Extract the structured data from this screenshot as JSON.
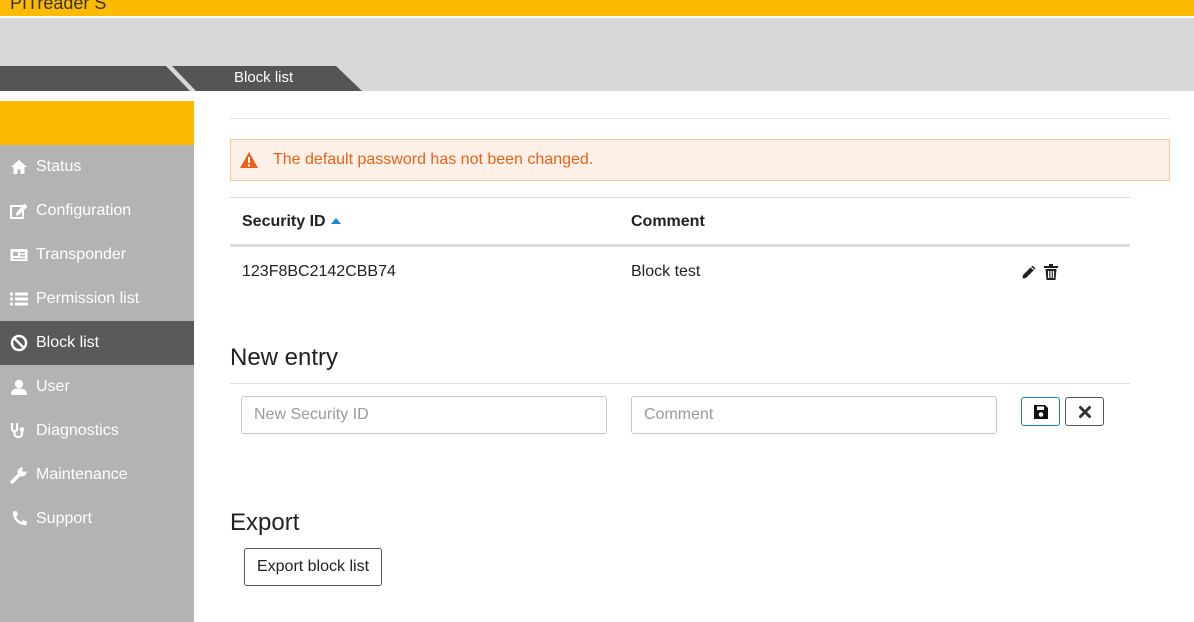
{
  "app": {
    "title": "PITreader S"
  },
  "breadcrumb": {
    "current": "Block list"
  },
  "sidebar": {
    "items": [
      {
        "label": "Status",
        "icon": "home-icon"
      },
      {
        "label": "Configuration",
        "icon": "edit-icon"
      },
      {
        "label": "Transponder",
        "icon": "id-card-icon"
      },
      {
        "label": "Permission list",
        "icon": "list-icon"
      },
      {
        "label": "Block list",
        "icon": "ban-icon",
        "active": true
      },
      {
        "label": "User",
        "icon": "user-icon"
      },
      {
        "label": "Diagnostics",
        "icon": "stethoscope-icon"
      },
      {
        "label": "Maintenance",
        "icon": "wrench-icon"
      },
      {
        "label": "Support",
        "icon": "phone-icon"
      }
    ]
  },
  "main": {
    "title": "Block list",
    "alert": {
      "text": "The default password has not been changed.",
      "icon": "warning-icon"
    },
    "table": {
      "columns": [
        "Security ID",
        "Comment"
      ],
      "sort": {
        "column": "Security ID",
        "direction": "ascending"
      },
      "rows": [
        {
          "security_id": "123F8BC2142CBB74",
          "comment": "Block test"
        }
      ]
    },
    "new_entry": {
      "title": "New entry",
      "security_id_placeholder": "New Security ID",
      "comment_placeholder": "Comment",
      "security_id_value": "",
      "comment_value": ""
    },
    "export": {
      "title": "Export",
      "button_label": "Export block list"
    }
  },
  "colors": {
    "brand_yellow": "#fcbb00",
    "sidebar_gray": "#b3b3b3",
    "sidebar_active": "#595959",
    "alert_text": "#e8621c",
    "alert_bg": "#fdf0e6",
    "sort_accent": "#1e88d9"
  }
}
